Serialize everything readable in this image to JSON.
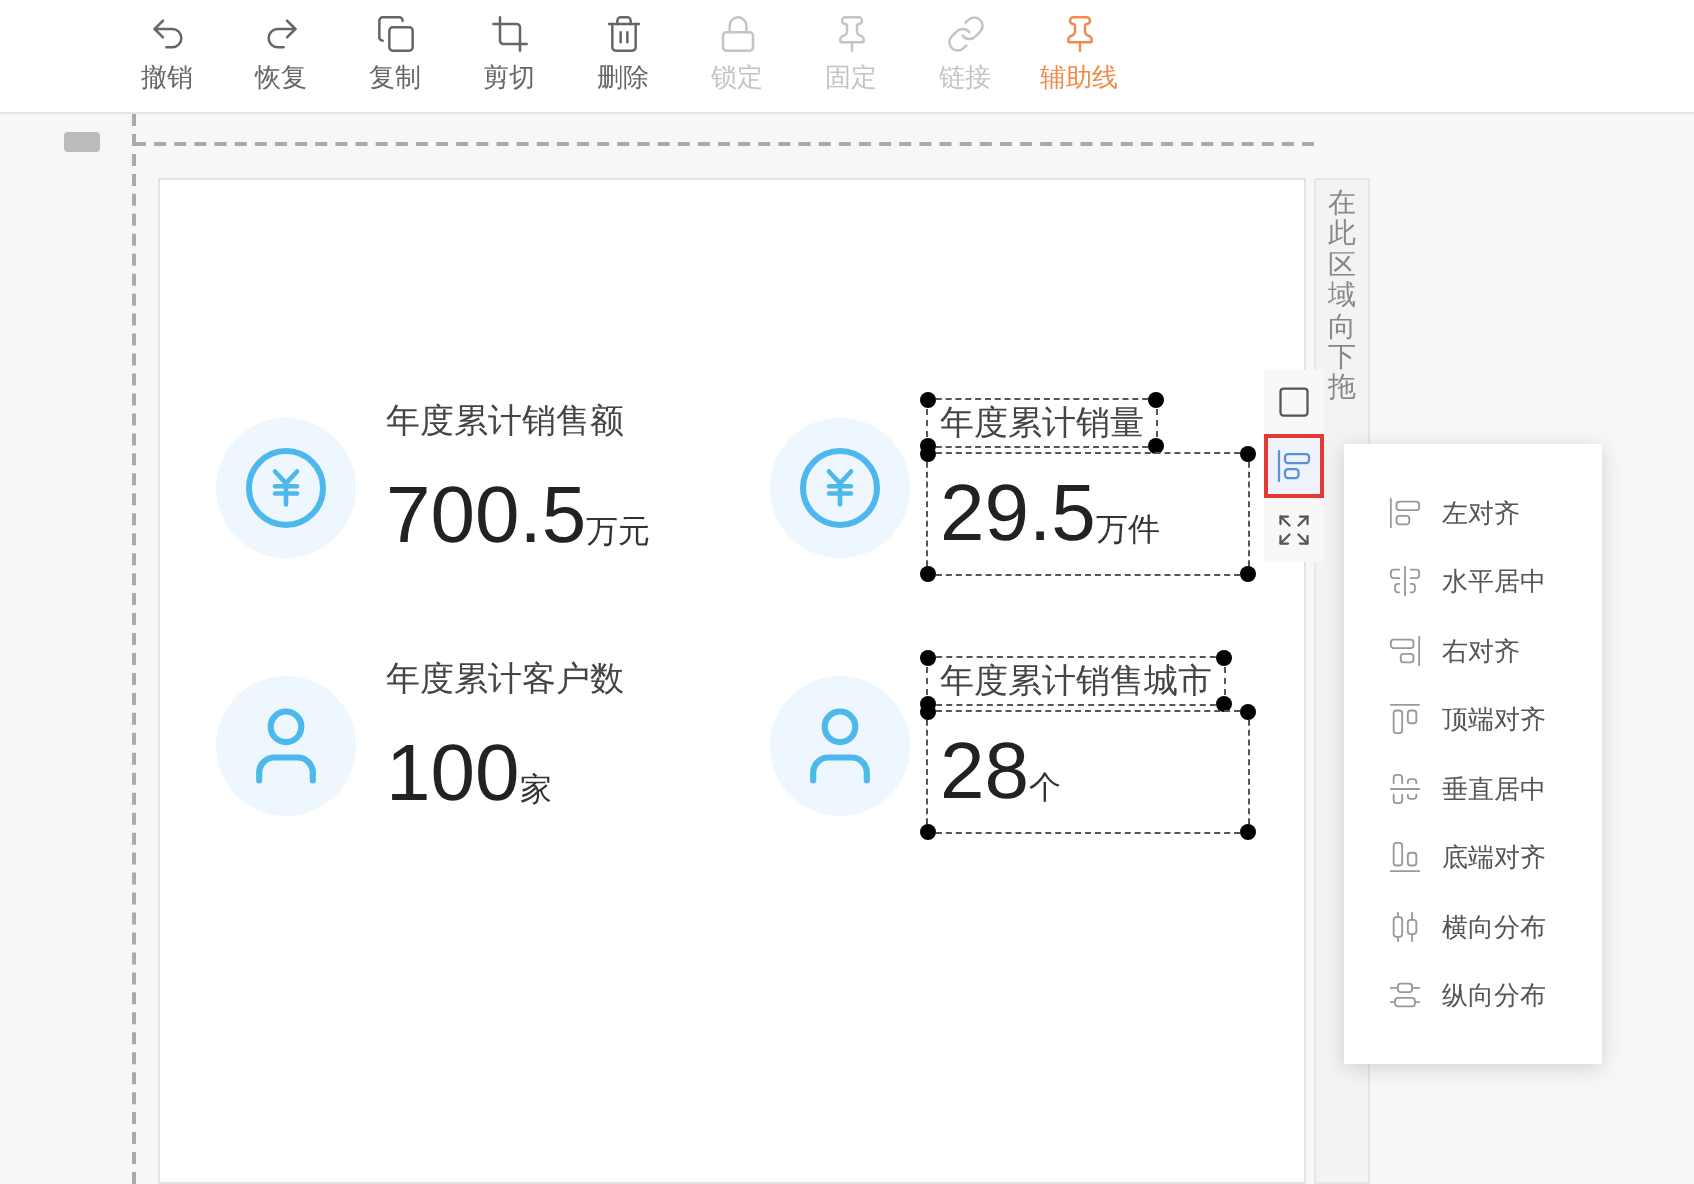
{
  "toolbar": [
    {
      "label": "撤销",
      "kind": "undo",
      "disabled": false,
      "active": false
    },
    {
      "label": "恢复",
      "kind": "redo",
      "disabled": false,
      "active": false
    },
    {
      "label": "复制",
      "kind": "copy",
      "disabled": false,
      "active": false
    },
    {
      "label": "剪切",
      "kind": "crop",
      "disabled": false,
      "active": false
    },
    {
      "label": "删除",
      "kind": "delete",
      "disabled": false,
      "active": false
    },
    {
      "label": "锁定",
      "kind": "lock",
      "disabled": true,
      "active": false
    },
    {
      "label": "固定",
      "kind": "pin",
      "disabled": true,
      "active": false
    },
    {
      "label": "链接",
      "kind": "link",
      "disabled": true,
      "active": false
    },
    {
      "label": "辅助线",
      "kind": "guide",
      "disabled": false,
      "active": true
    }
  ],
  "cards": [
    {
      "title": "年度累计销售额",
      "value": "700.5",
      "unit": "万元",
      "kind": "money",
      "selected": false
    },
    {
      "title": "年度累计销量",
      "value": "29.5",
      "unit": "万件",
      "kind": "money",
      "selected": true
    },
    {
      "title": "年度累计客户数",
      "value": "100",
      "unit": "家",
      "kind": "person",
      "selected": false
    },
    {
      "title": "年度累计销售城市",
      "value": "28",
      "unit": "个",
      "kind": "person",
      "selected": true
    }
  ],
  "side_tools": [
    {
      "kind": "frame",
      "selected": false
    },
    {
      "kind": "align",
      "selected": true
    },
    {
      "kind": "expand",
      "selected": false
    }
  ],
  "align_menu": [
    {
      "label": "左对齐",
      "kind": "left"
    },
    {
      "label": "水平居中",
      "kind": "hcenter"
    },
    {
      "label": "右对齐",
      "kind": "right"
    },
    {
      "label": "顶端对齐",
      "kind": "top"
    },
    {
      "label": "垂直居中",
      "kind": "vcenter"
    },
    {
      "label": "底端对齐",
      "kind": "bottom"
    },
    {
      "label": "横向分布",
      "kind": "hdist"
    },
    {
      "label": "纵向分布",
      "kind": "vdist"
    }
  ],
  "hint": "在此区域向下拖"
}
